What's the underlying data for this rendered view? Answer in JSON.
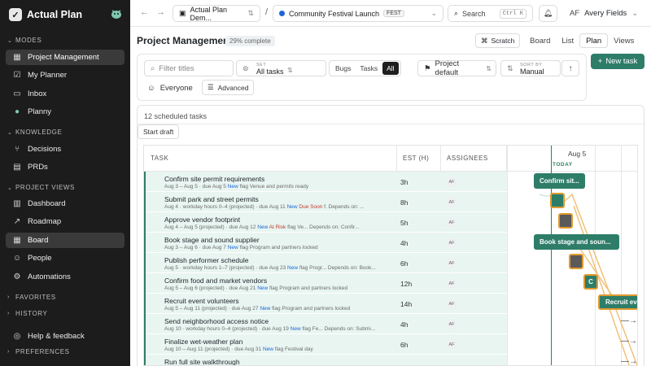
{
  "app": {
    "name": "Actual Plan"
  },
  "sidebar": {
    "modes_label": "MODES",
    "modes": [
      {
        "label": "Project Management",
        "icon": "project-icon"
      },
      {
        "label": "My Planner",
        "icon": "check-icon"
      },
      {
        "label": "Inbox",
        "icon": "inbox-icon"
      },
      {
        "label": "Planny",
        "icon": "planny-icon"
      }
    ],
    "knowledge_label": "KNOWLEDGE",
    "knowledge": [
      {
        "label": "Decisions",
        "icon": "decision-icon"
      },
      {
        "label": "PRDs",
        "icon": "document-icon"
      }
    ],
    "project_views_label": "PROJECT VIEWS",
    "project_views": [
      {
        "label": "Dashboard",
        "icon": "dashboard-icon"
      },
      {
        "label": "Roadmap",
        "icon": "roadmap-icon"
      },
      {
        "label": "Board",
        "icon": "board-icon"
      },
      {
        "label": "People",
        "icon": "people-icon"
      },
      {
        "label": "Automations",
        "icon": "automation-icon"
      }
    ],
    "favorites_label": "FAVORITES",
    "history_label": "HISTORY",
    "help_label": "Help & feedback",
    "preferences_label": "PREFERENCES"
  },
  "topbar": {
    "workspace": "Actual Plan Dem...",
    "project": "Community Festival Launch",
    "project_tag": "FEST",
    "search_label": "Search",
    "search_kbd": "Ctrl K",
    "user_initials": "AF",
    "user_name": "Avery Fields"
  },
  "header": {
    "title": "Project Management",
    "progress": "29% complete",
    "scratch": "Scratch",
    "views": [
      "Board",
      "List",
      "Plan",
      "Views"
    ],
    "active_view": "Plan"
  },
  "filters": {
    "search_placeholder": "Filter titles",
    "set_caption": "SET",
    "set_value": "All tasks",
    "type_options": [
      "Bugs",
      "Tasks",
      "All"
    ],
    "project_default": "Project default",
    "sort_caption": "SORT BY",
    "sort_value": "Manual",
    "everyone": "Everyone",
    "advanced": "Advanced"
  },
  "new_task": "New task",
  "timeline": {
    "count_label": "12 scheduled tasks",
    "start_draft": "Start draft",
    "columns": {
      "task": "TASK",
      "est": "EST (H)",
      "assignees": "ASSIGNEES"
    },
    "date_label": "Aug 5",
    "today_label": "TODAY",
    "rows": [
      {
        "name": "Confirm site permit requirements",
        "meta_a": "Aug 3 – Aug 5 · due Aug 5 ",
        "new": "New",
        "meta_b": " flag Venue and permits ready",
        "est": "3h",
        "assignee": "AF"
      },
      {
        "name": "Submit park and street permits",
        "meta_a": "Aug 4 · workday hours 0–4 (projected) · due Aug 11 ",
        "new": "New",
        "due": " Due Soon",
        "meta_b": " f.   Depends on: ...",
        "est": "8h",
        "assignee": "AF"
      },
      {
        "name": "Approve vendor footprint",
        "meta_a": "Aug 4 – Aug 5 (projected) · due Aug 12 ",
        "new": "New",
        "due": " At Risk",
        "meta_b": " flag Ve...   Depends on: Confir...",
        "est": "5h",
        "assignee": "AF"
      },
      {
        "name": "Book stage and sound supplier",
        "meta_a": "Aug 3 – Aug 6 · due Aug 7 ",
        "new": "New",
        "meta_b": " flag Program and partners locked",
        "est": "4h",
        "assignee": "AF"
      },
      {
        "name": "Publish performer schedule",
        "meta_a": "Aug 5 · workday hours 1–7 (projected) · due Aug 23 ",
        "new": "New",
        "meta_b": " flag Progr...   Depends on: Book...",
        "est": "6h",
        "assignee": "AF"
      },
      {
        "name": "Confirm food and market vendors",
        "meta_a": "Aug 5 – Aug 6 (projected) · due Aug 21 ",
        "new": "New",
        "meta_b": " flag Program and partners locked",
        "est": "12h",
        "assignee": "AF"
      },
      {
        "name": "Recruit event volunteers",
        "meta_a": "Aug 5 – Aug 11 (projected) · due Aug 27 ",
        "new": "New",
        "meta_b": " flag Program and partners locked",
        "est": "14h",
        "assignee": "AF"
      },
      {
        "name": "Send neighborhood access notice",
        "meta_a": "Aug 10 · workday hours 0–4 (projected) · due Aug 19 ",
        "new": "New",
        "meta_b": " flag Fe...   Depends on: Submi...",
        "est": "4h",
        "assignee": "AF"
      },
      {
        "name": "Finalize wet-weather plan",
        "meta_a": "Aug 10 – Aug 11 (projected) · due Aug 31 ",
        "new": "New",
        "meta_b": " flag Festival day",
        "est": "6h",
        "assignee": "AF"
      },
      {
        "name": "Run full site walkthrough",
        "meta_a": "",
        "new": "",
        "meta_b": "",
        "est": "",
        "assignee": ""
      }
    ],
    "bars": [
      "Confirm sit...",
      "",
      "",
      "Book stage and soun...",
      "",
      "C",
      "Recruit eve"
    ]
  },
  "colors": {
    "accent": "#2e7d69",
    "row_bg": "#e8f5f1",
    "warning": "#e09a2e",
    "sidebar": "#1c1c1c"
  }
}
